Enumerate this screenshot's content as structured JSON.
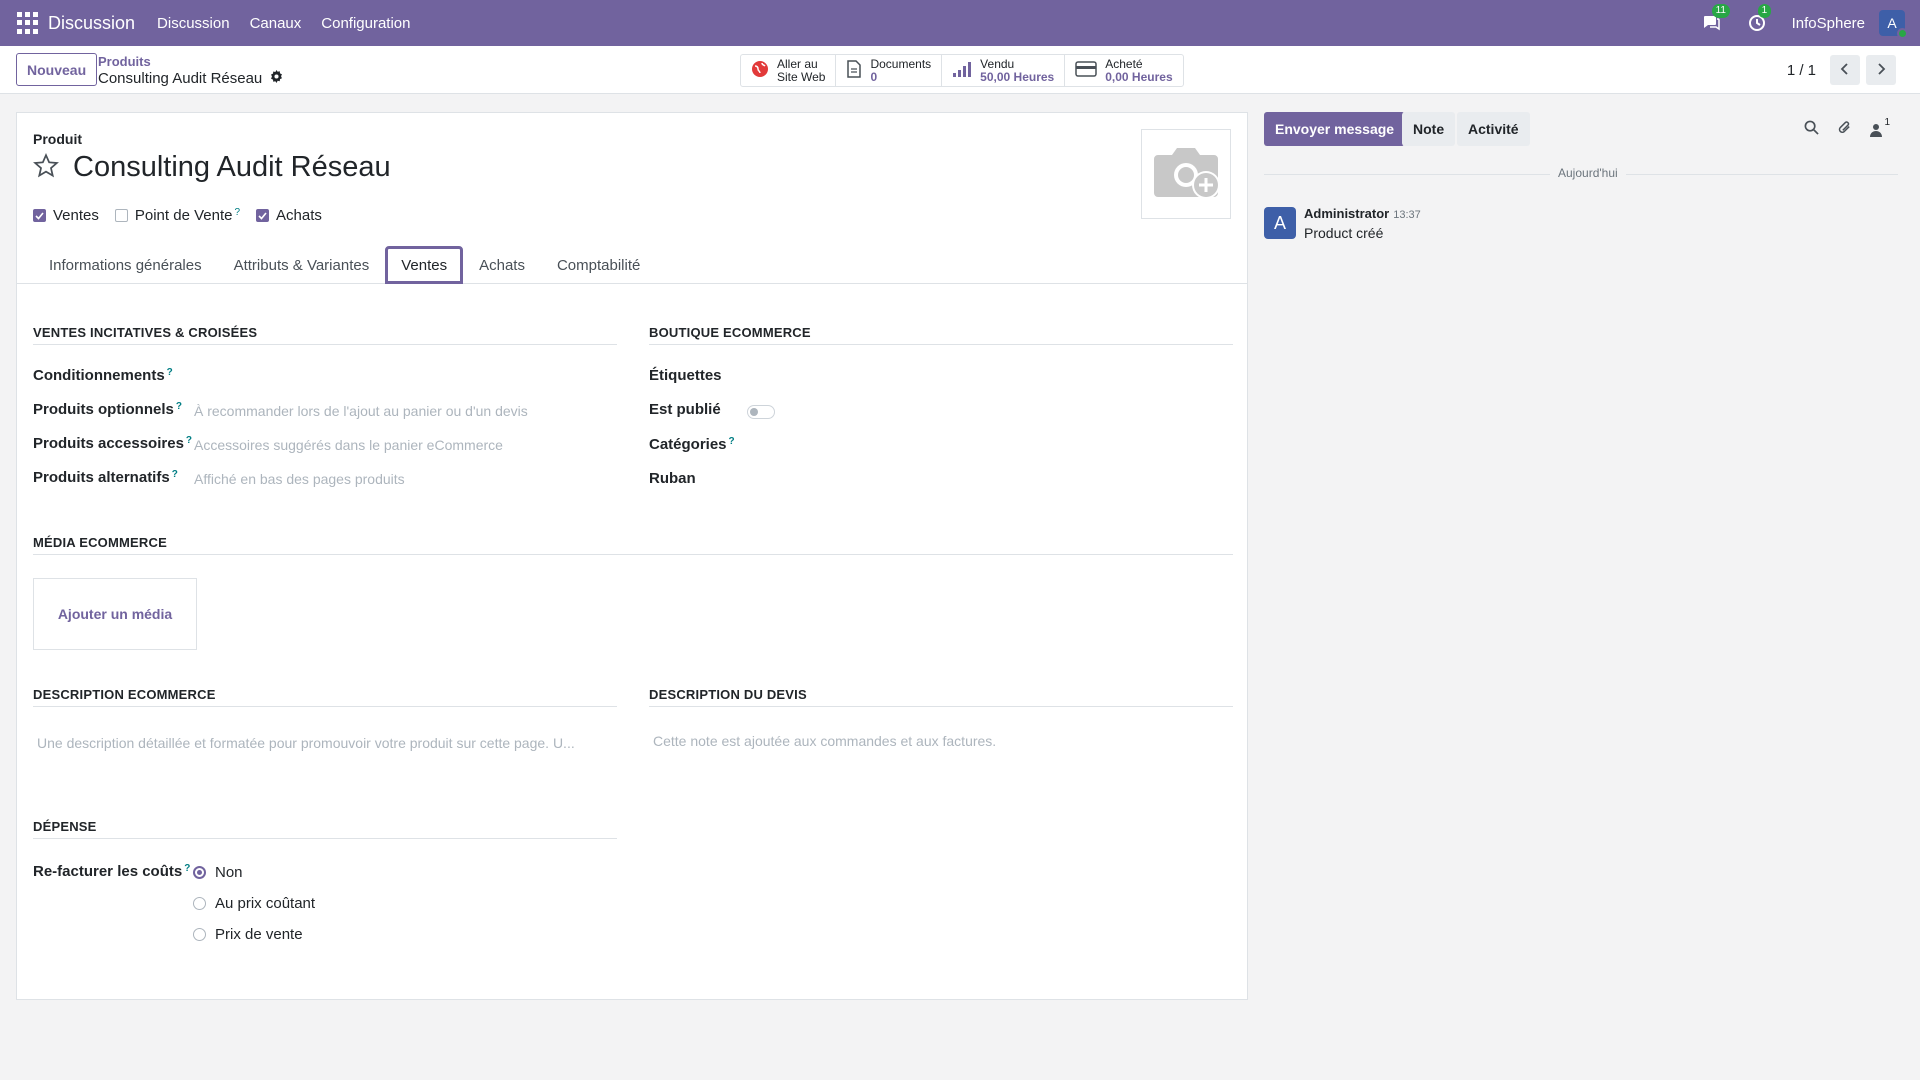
{
  "navbar": {
    "brand": "Discussion",
    "menu": [
      "Discussion",
      "Canaux",
      "Configuration"
    ],
    "messages_count": "11",
    "activities_count": "1",
    "company": "InfoSphere",
    "user_initial": "A"
  },
  "control": {
    "new_label": "Nouveau",
    "breadcrumb_parent": "Produits",
    "breadcrumb_current": "Consulting Audit Réseau",
    "pager": "1 / 1",
    "smart_buttons": {
      "website": {
        "line1": "Aller au",
        "line2": "Site Web"
      },
      "documents": {
        "label": "Documents",
        "value": "0"
      },
      "sold": {
        "label": "Vendu",
        "value": "50,00 Heures"
      },
      "purchased": {
        "label": "Acheté",
        "value": "0,00 Heures"
      }
    }
  },
  "form": {
    "product_label": "Produit",
    "product_name": "Consulting Audit Réseau",
    "flags": {
      "sales": "Ventes",
      "pos": "Point de Vente",
      "purchase": "Achats",
      "help": "?"
    },
    "tabs": [
      "Informations générales",
      "Attributs & Variantes",
      "Ventes",
      "Achats",
      "Comptabilité"
    ],
    "upsell": {
      "title": "VENTES INCITATIVES & CROISÉES",
      "packaging": "Conditionnements",
      "optional": "Produits optionnels",
      "optional_ph": "À recommander lors de l'ajout au panier ou d'un devis",
      "accessory": "Produits accessoires",
      "accessory_ph": "Accessoires suggérés dans le panier eCommerce",
      "alternative": "Produits alternatifs",
      "alternative_ph": "Affiché en bas des pages produits"
    },
    "shop": {
      "title": "BOUTIQUE ECOMMERCE",
      "tags": "Étiquettes",
      "published": "Est publié",
      "categories": "Catégories",
      "ribbon": "Ruban"
    },
    "media": {
      "title": "MÉDIA ECOMMERCE",
      "add": "Ajouter un média"
    },
    "ecom_desc": {
      "title": "DESCRIPTION ECOMMERCE",
      "ph": "Une description détaillée et formatée pour promouvoir votre produit sur cette page. U..."
    },
    "quote_desc": {
      "title": "DESCRIPTION DU DEVIS",
      "ph": "Cette note est ajoutée aux commandes et aux factures."
    },
    "expense": {
      "title": "DÉPENSE",
      "label": "Re-facturer les coûts",
      "options": [
        "Non",
        "Au prix coûtant",
        "Prix de vente"
      ]
    }
  },
  "chatter": {
    "send": "Envoyer message",
    "note": "Note",
    "activity": "Activité",
    "followers": "1",
    "today": "Aujourd'hui",
    "author": "Administrator",
    "time": "13:37",
    "body": "Product créé",
    "initial": "A"
  }
}
